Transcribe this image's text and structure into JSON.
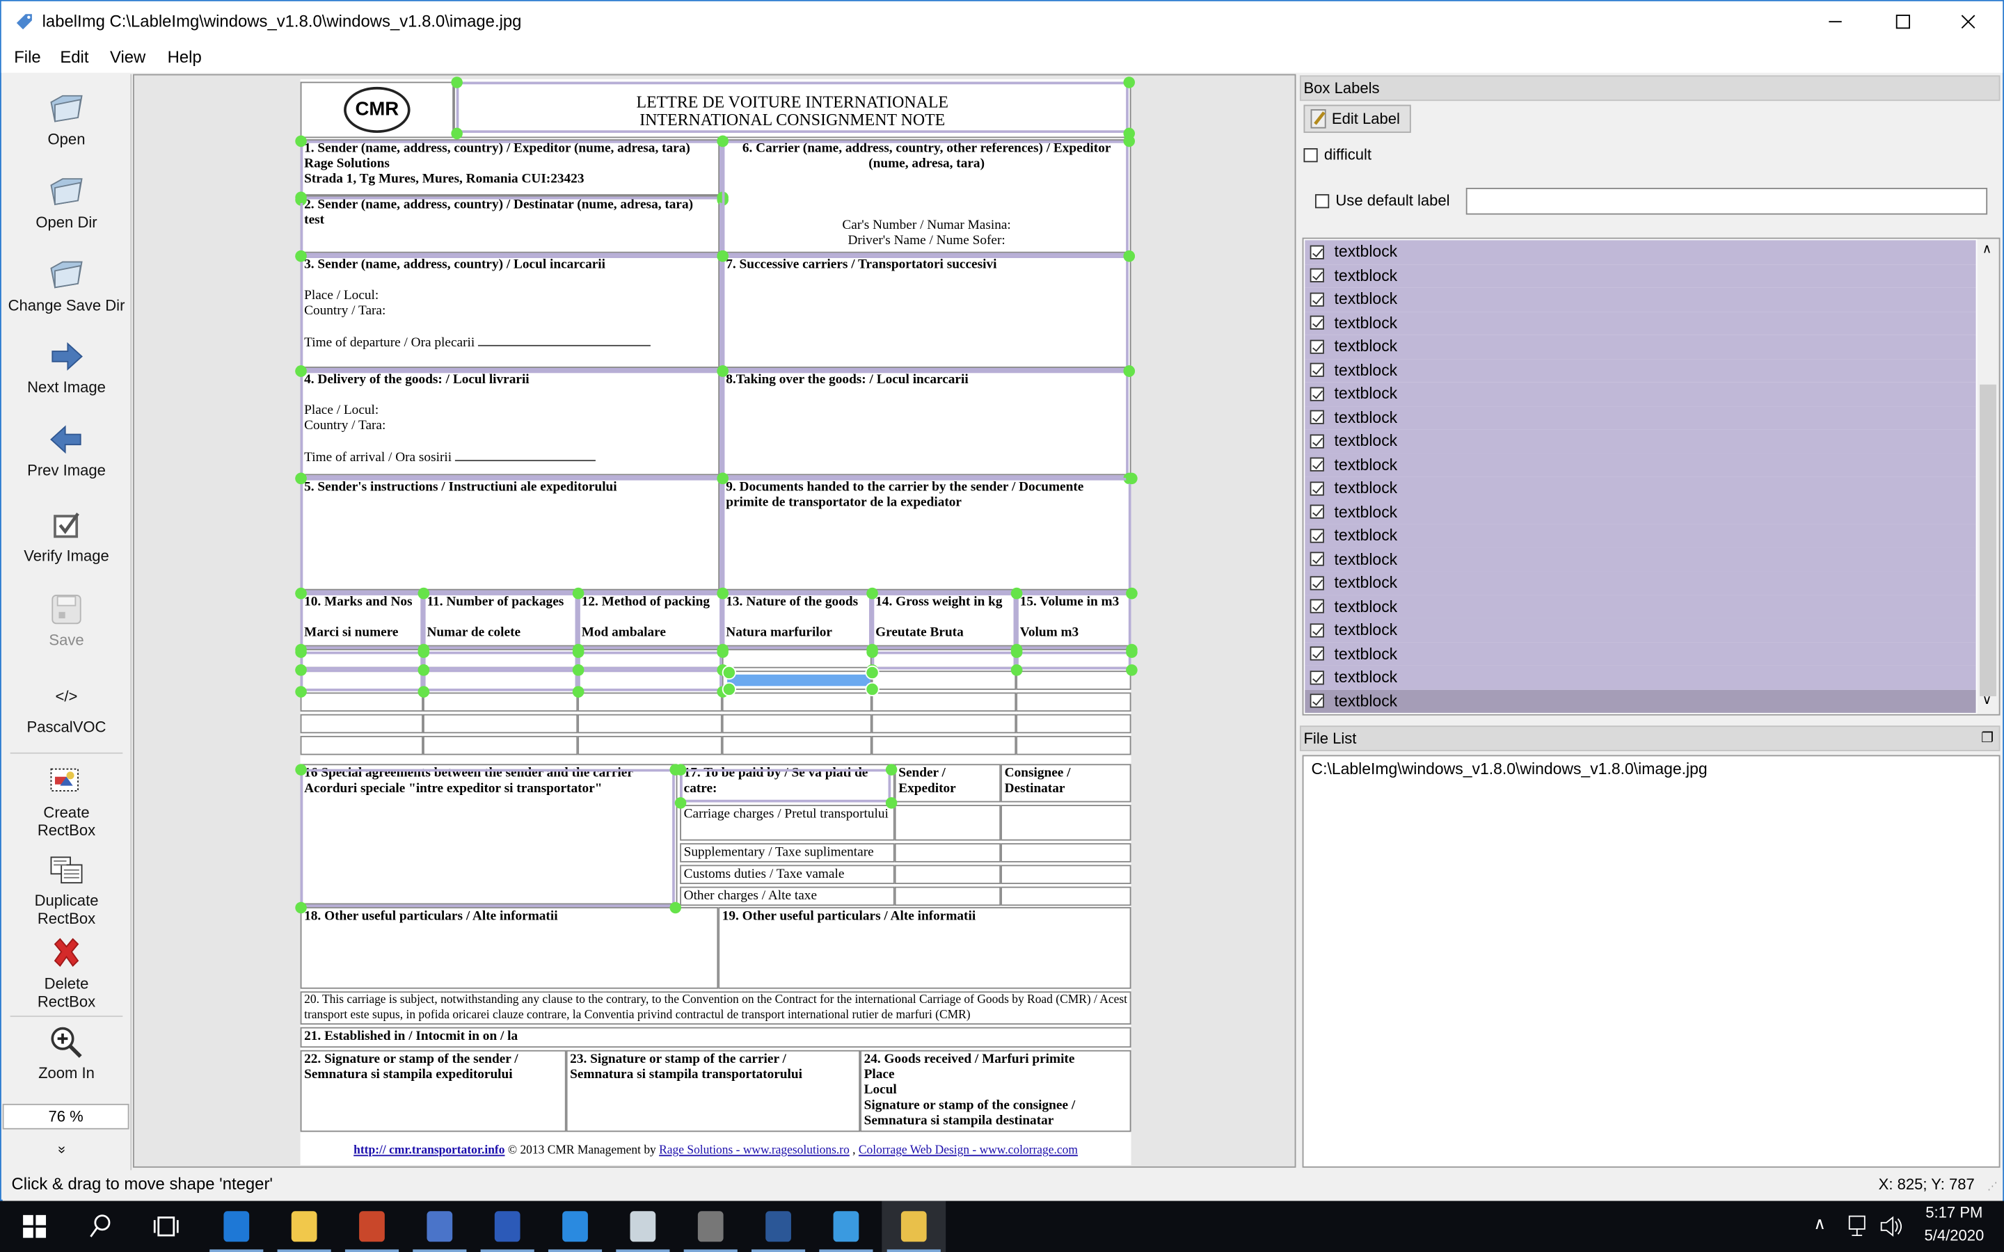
{
  "window": {
    "title": "labelImg C:\\LableImg\\windows_v1.8.0\\windows_v1.8.0\\image.jpg",
    "controls": {
      "minimize": "—",
      "maximize": "☐",
      "close": "✕"
    }
  },
  "menu": [
    "File",
    "Edit",
    "View",
    "Help"
  ],
  "toolbar": {
    "items": [
      {
        "label": "Open",
        "icon": "folder-icon"
      },
      {
        "label": "Open Dir",
        "icon": "folder-icon"
      },
      {
        "label": "Change Save Dir",
        "icon": "folder-icon"
      },
      {
        "label": "Next Image",
        "icon": "arrow-right-icon"
      },
      {
        "label": "Prev Image",
        "icon": "arrow-left-icon"
      },
      {
        "label": "Verify Image",
        "icon": "checkbox-icon"
      },
      {
        "label": "Save",
        "icon": "floppy-icon",
        "disabled": true
      },
      {
        "label": "PascalVOC",
        "icon": "code-icon",
        "glyph": "</>"
      },
      {
        "label": "Create\nRectBox",
        "label1": "Create",
        "label2": "RectBox",
        "icon": "create-rect-icon"
      },
      {
        "label1": "Duplicate",
        "label2": "RectBox",
        "icon": "duplicate-icon"
      },
      {
        "label1": "Delete",
        "label2": "RectBox",
        "icon": "delete-x-icon"
      },
      {
        "label": "Zoom In",
        "icon": "zoom-in-icon"
      }
    ],
    "zoom_value": "76 %",
    "more": "»"
  },
  "document": {
    "logo": "CMR",
    "title_line1": "LETTRE DE VOITURE INTERNATIONALE",
    "title_line2": "INTERNATIONAL CONSIGNMENT NOTE",
    "box1_title": "1. Sender (name, address, country) / Expeditor (nume, adresa, tara)",
    "box1_line1": "Rage Solutions",
    "box1_line2": "Strada 1, Tg Mures, Mures, Romania CUI:23423",
    "box2_title": "2. Sender (name, address, country) / Destinatar (nume, adresa, tara)",
    "box2_line1": "test",
    "box6_title": "6. Carrier (name, address, country, other references) / Expeditor (nume, adresa, tara)",
    "box6_car": "Car's Number / Numar Masina:",
    "box6_driver": "Driver's Name / Nume Sofer:",
    "box3_title": "3. Sender (name, address, country) / Locul incarcarii",
    "box3_place": "Place / Locul:",
    "box3_country": "Country / Tara:",
    "box3_time": "Time of departure / Ora plecarii",
    "box7_title": "7. Successive carriers / Transportatori succesivi",
    "box4_title": "4. Delivery of the goods: / Locul livrarii",
    "box4_place": "Place / Locul:",
    "box4_country": "Country / Tara:",
    "box4_time": "Time of arrival / Ora sosirii",
    "box8_title": "8.Taking over the goods: / Locul incarcarii",
    "box5_title": "5. Sender's instructions / Instructiuni ale expeditorului",
    "box9_title": "9. Documents handed to the carrier by the sender / Documente primite de transportator de la expediator",
    "goods_columns": [
      {
        "title": "10. Marks and Nos",
        "sub": "Marci si numere"
      },
      {
        "title": "11. Number of packages",
        "sub": "Numar de colete"
      },
      {
        "title": "12. Method of packing",
        "sub": "Mod ambalare"
      },
      {
        "title": "13. Nature of the goods",
        "sub": "Natura marfurilor"
      },
      {
        "title": "14. Gross weight in kg",
        "sub": "Greutate Bruta"
      },
      {
        "title": "15. Volume in m3",
        "sub": "Volum m3"
      }
    ],
    "box16_line1": "16 Special agreements between the sender and the carrier",
    "box16_line2": "Acorduri speciale \"intre expeditor si transportator\"",
    "box17_title": "17. To be paid by / Se va plati de catre:",
    "box17_col_sender": "Sender / Expeditor",
    "box17_col_consignee": "Consignee / Destinatar",
    "box17_rows": [
      "Carriage charges / Pretul transportului",
      "Supplementary / Taxe suplimentare",
      "Customs duties / Taxe vamale",
      "Other charges / Alte taxe"
    ],
    "box18_title": "18. Other useful particulars / Alte informatii",
    "box19_title": "19. Other useful particulars / Alte informatii",
    "box20_text": "20. This carriage is subject, notwithstanding any clause to the contrary, to the Convention on the Contract for the international Carriage of Goods by Road (CMR) / Acest transport este supus, in pofida oricarei clauze contrare, la Conventia privind contractul de transport international rutier de marfuri (CMR)",
    "box21_title": "21. Established in / Intocmit in on / la",
    "box22_line1": "22. Signature or stamp of the sender /",
    "box22_line2": "Semnatura si stampila expeditorului",
    "box23_line1": "23. Signature or stamp of the carrier /",
    "box23_line2": "Semnatura si stampila transportatorului",
    "box24_line1": "24. Goods received / Marfuri primite",
    "box24_line2": "Place",
    "box24_line3": "Locul",
    "box24_line4": "Signature or stamp of the consignee /",
    "box24_line5": "Semnatura si stampila destinatar",
    "footer_link1": "http:// cmr.transportator.info",
    "footer_text": " © 2013 CMR Management by ",
    "footer_link2": "Rage Solutions - www.ragesolutions.ro",
    "footer_sep": " , ",
    "footer_link3": "Colorrage Web Design - www.colorrage.com"
  },
  "box_labels": {
    "title": "Box Labels",
    "edit_label": "Edit Label",
    "difficult": "difficult",
    "difficult_checked": false,
    "use_default_label": "Use default label",
    "use_default_checked": false,
    "default_label_value": "",
    "items": [
      "textblock",
      "textblock",
      "textblock",
      "textblock",
      "textblock",
      "textblock",
      "textblock",
      "textblock",
      "textblock",
      "textblock",
      "textblock",
      "textblock",
      "textblock",
      "textblock",
      "textblock",
      "textblock",
      "textblock",
      "textblock",
      "textblock",
      "textblock"
    ],
    "selected_index": 19,
    "highlight_color": "#c0b8d7",
    "selected_color": "#a59db7"
  },
  "file_list": {
    "title": "File List",
    "items": [
      "C:\\LableImg\\windows_v1.8.0\\windows_v1.8.0\\image.jpg"
    ]
  },
  "status": {
    "message": "Click & drag to move shape 'nteger'",
    "coords": "X: 825; Y: 787"
  },
  "taskbar": {
    "apps": [
      "start-icon",
      "search-icon",
      "task-view-icon",
      "edge-icon",
      "file-explorer-icon",
      "powerpoint-icon",
      "remote-desktop-icon",
      "powershell-icon",
      "vscode-icon",
      "window-app-icon",
      "lock-app-icon",
      "word-icon",
      "internet-explorer-icon",
      "python-labelimg-icon"
    ],
    "time": "5:17 PM",
    "date": "5/4/2020"
  },
  "colors": {
    "box_outline": "#b7aed6",
    "handle": "#66e34a",
    "selected_fill": "#6aa9f0",
    "window_border": "#2b7bd0"
  }
}
